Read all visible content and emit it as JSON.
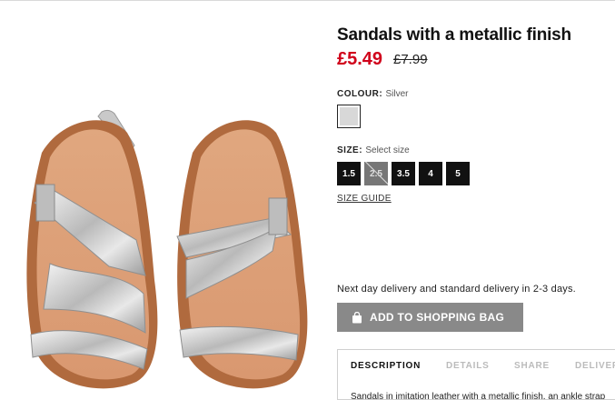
{
  "product": {
    "title": "Sandals with a metallic finish",
    "price": "£5.49",
    "old_price": "£7.99"
  },
  "colour": {
    "label": "COLOUR:",
    "value": "Silver",
    "swatch_color": "#d8d8d8"
  },
  "size": {
    "label": "SIZE:",
    "value": "Select size",
    "options": [
      {
        "label": "1.5",
        "available": true
      },
      {
        "label": "2.5",
        "available": false
      },
      {
        "label": "3.5",
        "available": true
      },
      {
        "label": "4",
        "available": true
      },
      {
        "label": "5",
        "available": true
      }
    ],
    "guide_label": "SIZE GUIDE"
  },
  "delivery_text": "Next day delivery and standard delivery in 2-3 days.",
  "add_to_bag": {
    "label": "ADD TO SHOPPING BAG",
    "icon": "shopping-bag-icon"
  },
  "tabs": [
    {
      "label": "DESCRIPTION",
      "active": true
    },
    {
      "label": "DETAILS",
      "active": false
    },
    {
      "label": "SHARE",
      "active": false
    },
    {
      "label": "DELIVERY",
      "active": false
    }
  ],
  "description": "Sandals in imitation leather with a metallic finish, an ankle strap",
  "colors": {
    "price_red": "#d0021b",
    "button_grey": "#898989"
  }
}
